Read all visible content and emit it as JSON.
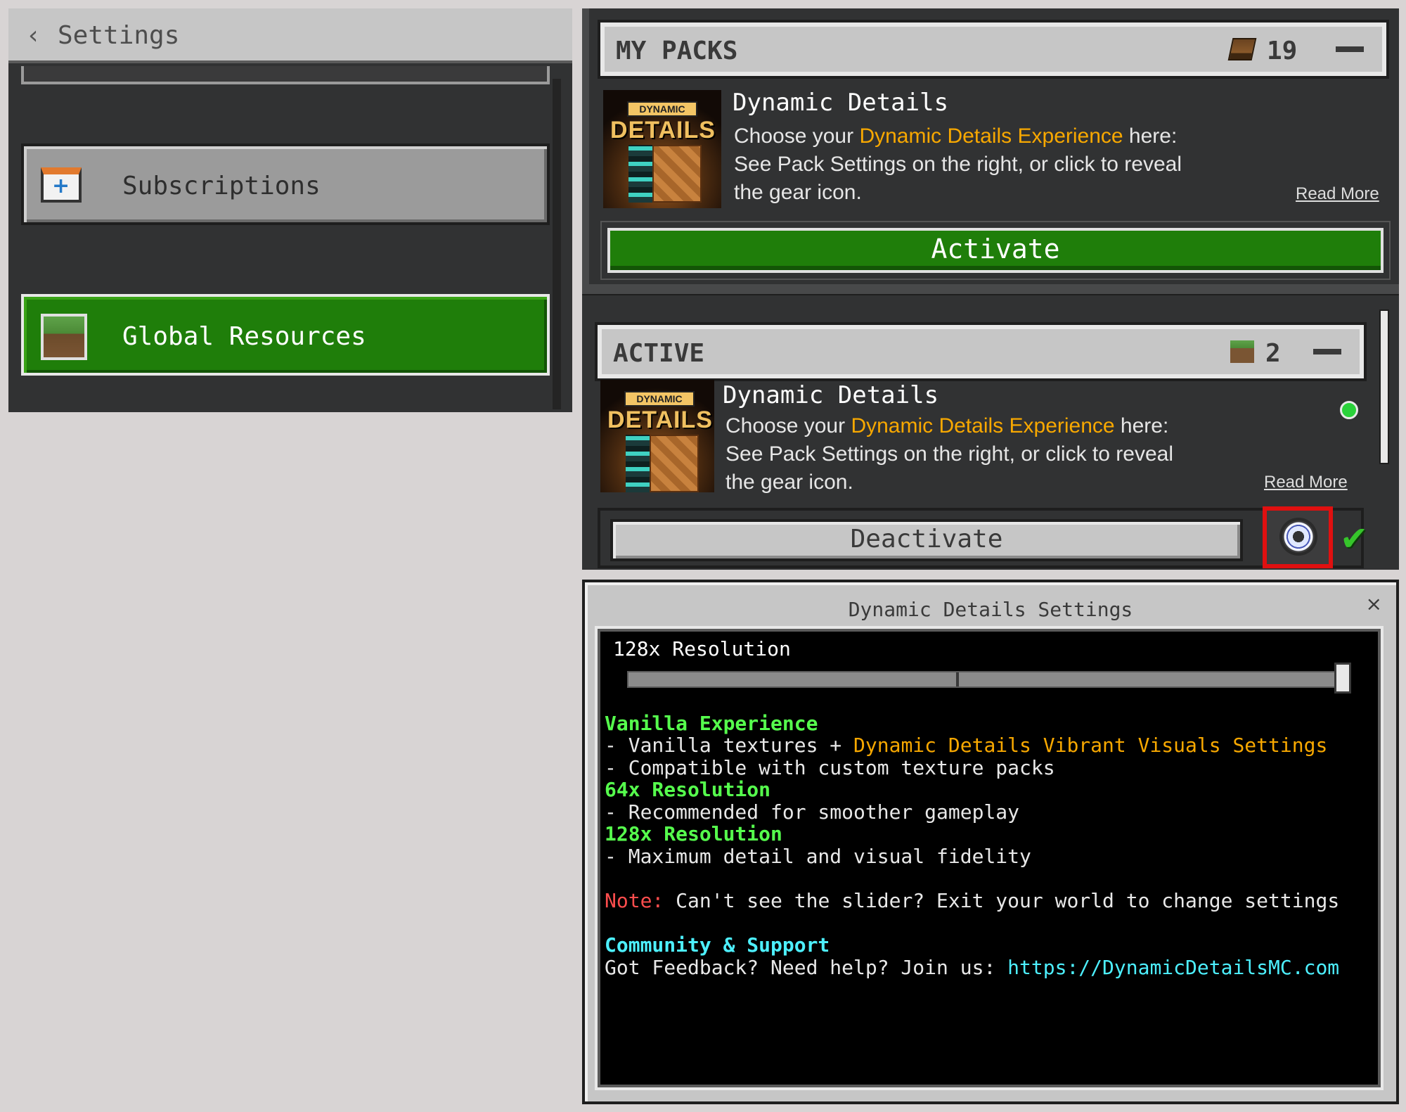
{
  "settings": {
    "back_icon": "chevron-left-icon",
    "title": "Settings",
    "nav": [
      {
        "label": "Subscriptions",
        "icon": "calendar-plus-icon"
      },
      {
        "label": "Global Resources",
        "icon": "grass-block-icon"
      }
    ]
  },
  "my_packs": {
    "title": "MY PACKS",
    "icon": "book-icon",
    "count": "19",
    "pack": {
      "thumb_badge": "DYNAMIC",
      "thumb_title": "DETAILS",
      "name": "Dynamic Details",
      "desc_pre": "Choose your ",
      "desc_highlight": "Dynamic Details Experience",
      "desc_post": " here:",
      "desc_line2": "See Pack Settings on the right, or click to reveal",
      "desc_line3": "the gear icon.",
      "read_more": "Read More"
    },
    "action": "Activate"
  },
  "active": {
    "title": "ACTIVE",
    "icon": "grass-block-icon",
    "count": "2",
    "pack": {
      "thumb_badge": "DYNAMIC",
      "thumb_title": "DETAILS",
      "name": "Dynamic Details",
      "desc_pre": "Choose your ",
      "desc_highlight": "Dynamic Details Experience",
      "desc_post": " here:",
      "desc_line2": "See Pack Settings on the right, or click to reveal",
      "desc_line3": "the gear icon.",
      "read_more": "Read More"
    },
    "action": "Deactivate"
  },
  "dialog": {
    "title": "Dynamic Details Settings",
    "close": "×",
    "slider_label": "128x Resolution",
    "slider_value_fraction": 1.0,
    "lines": {
      "h1": "Vanilla Experience",
      "l1_pre": "- Vanilla textures + ",
      "l1_hl": "Dynamic Details Vibrant Visuals Settings",
      "l2": "- Compatible with custom texture packs",
      "h2": "64x Resolution",
      "l3": "- Recommended for smoother gameplay",
      "h3": "128x Resolution",
      "l4": "- Maximum detail and visual fidelity",
      "note_label": "Note:",
      "note_text": " Can't see the slider? Exit your world to change settings",
      "h4": "Community & Support",
      "support_pre": "Got Feedback? Need help? Join us: ",
      "support_link": "https://DynamicDetailsMC.com"
    }
  },
  "colors": {
    "green_button": "#1f7e0a",
    "highlight": "#f8a800",
    "heading_green": "#56ff4d",
    "heading_cyan": "#4df0ff",
    "note_red": "#ff4d4d",
    "gear_outline": "#e01010"
  }
}
